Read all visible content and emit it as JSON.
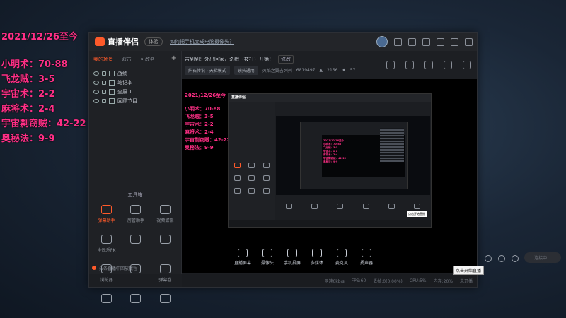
{
  "overlay": {
    "date": "2021/12/26至今",
    "lines": [
      "小明术：70-88",
      "飞龙贼：3-5",
      "宇宙术：2-2",
      "麻将术：2-4",
      "宇宙剽窃贼：42-22",
      "奥秘法：9-9"
    ]
  },
  "app": {
    "name": "直播伴侣",
    "badge": "体验",
    "notice": "如何把手机变成电脑摄像头？",
    "tabs": [
      "我的场景",
      "双击",
      "可改名"
    ],
    "plus": "+",
    "scenes": [
      "战绩",
      "笔记本",
      "全屏 1",
      "回顾节目"
    ],
    "tools_title": "工具箱",
    "tools": [
      "弹幕助手",
      "房管助手",
      "视频滤镜",
      "全民乐PK",
      "",
      "",
      "浏览器",
      "",
      "弹幕卷",
      "",
      "",
      ""
    ],
    "sidebar_footer": "头条直播中回放教程",
    "live_title": "吉列列：外出回家，杀戮（技打）开始！",
    "edit_label": "修改",
    "category": "炉石传说 · 天梯模式",
    "pill": "镜头通用",
    "room_info": "火焰之翼吉列列",
    "room_id": "6819497",
    "viewers": "2156",
    "likes": "57",
    "controls": [
      "直播屏幕",
      "摄像头",
      "手机投屏",
      "多媒体",
      "麦克风",
      "扬声器"
    ],
    "start_label": "连接中...",
    "tooltip": "点击开始直播",
    "status": [
      "网速0kb/s",
      "FPS:60",
      "丢帧:0(0.00%)",
      "CPU:5%",
      "内存:20%",
      "未开播"
    ]
  },
  "nested": {
    "date": "2021/12/26至今",
    "lines": [
      "小明术：70-88",
      "飞龙贼：3-5",
      "宇宙术：2-2",
      "麻将术：2-4",
      "宇宙剽窃贼：42-22",
      "奥秘法：9-9"
    ],
    "title": "直播伴侣",
    "tooltip": "点击开始直播"
  },
  "colors": {
    "accent": "#ff5a2a",
    "overlay_text": "#ff2f86"
  }
}
